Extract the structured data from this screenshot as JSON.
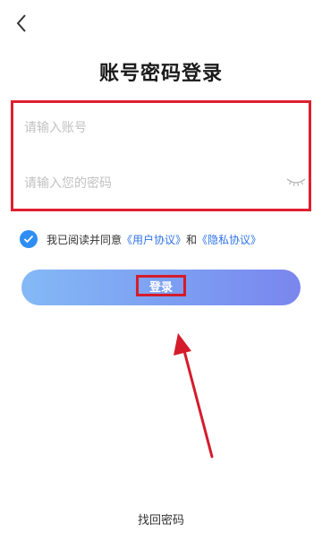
{
  "header": {
    "back_icon": "chevron-left-icon"
  },
  "title": "账号密码登录",
  "form": {
    "account_placeholder": "请输入账号",
    "account_value": "",
    "password_placeholder": "请输入您的密码",
    "password_value": "",
    "password_toggle_icon": "eye-closed-icon",
    "highlight_color": "#e02030"
  },
  "agreement": {
    "checked": true,
    "prefix": "我已阅读并同意",
    "user_agreement": "《用户协议》",
    "conjunction": "和",
    "privacy_agreement": "《隐私协议》",
    "check_icon": "check-circle-icon",
    "accent_color": "#2f8ef5"
  },
  "login_button": {
    "label": "登录",
    "gradient_start": "#84b9f6",
    "gradient_end": "#7a86ee"
  },
  "annotation": {
    "arrow_icon": "red-arrow-pointer",
    "color": "#d41c2c"
  },
  "footer": {
    "forgot_password": "找回密码"
  }
}
